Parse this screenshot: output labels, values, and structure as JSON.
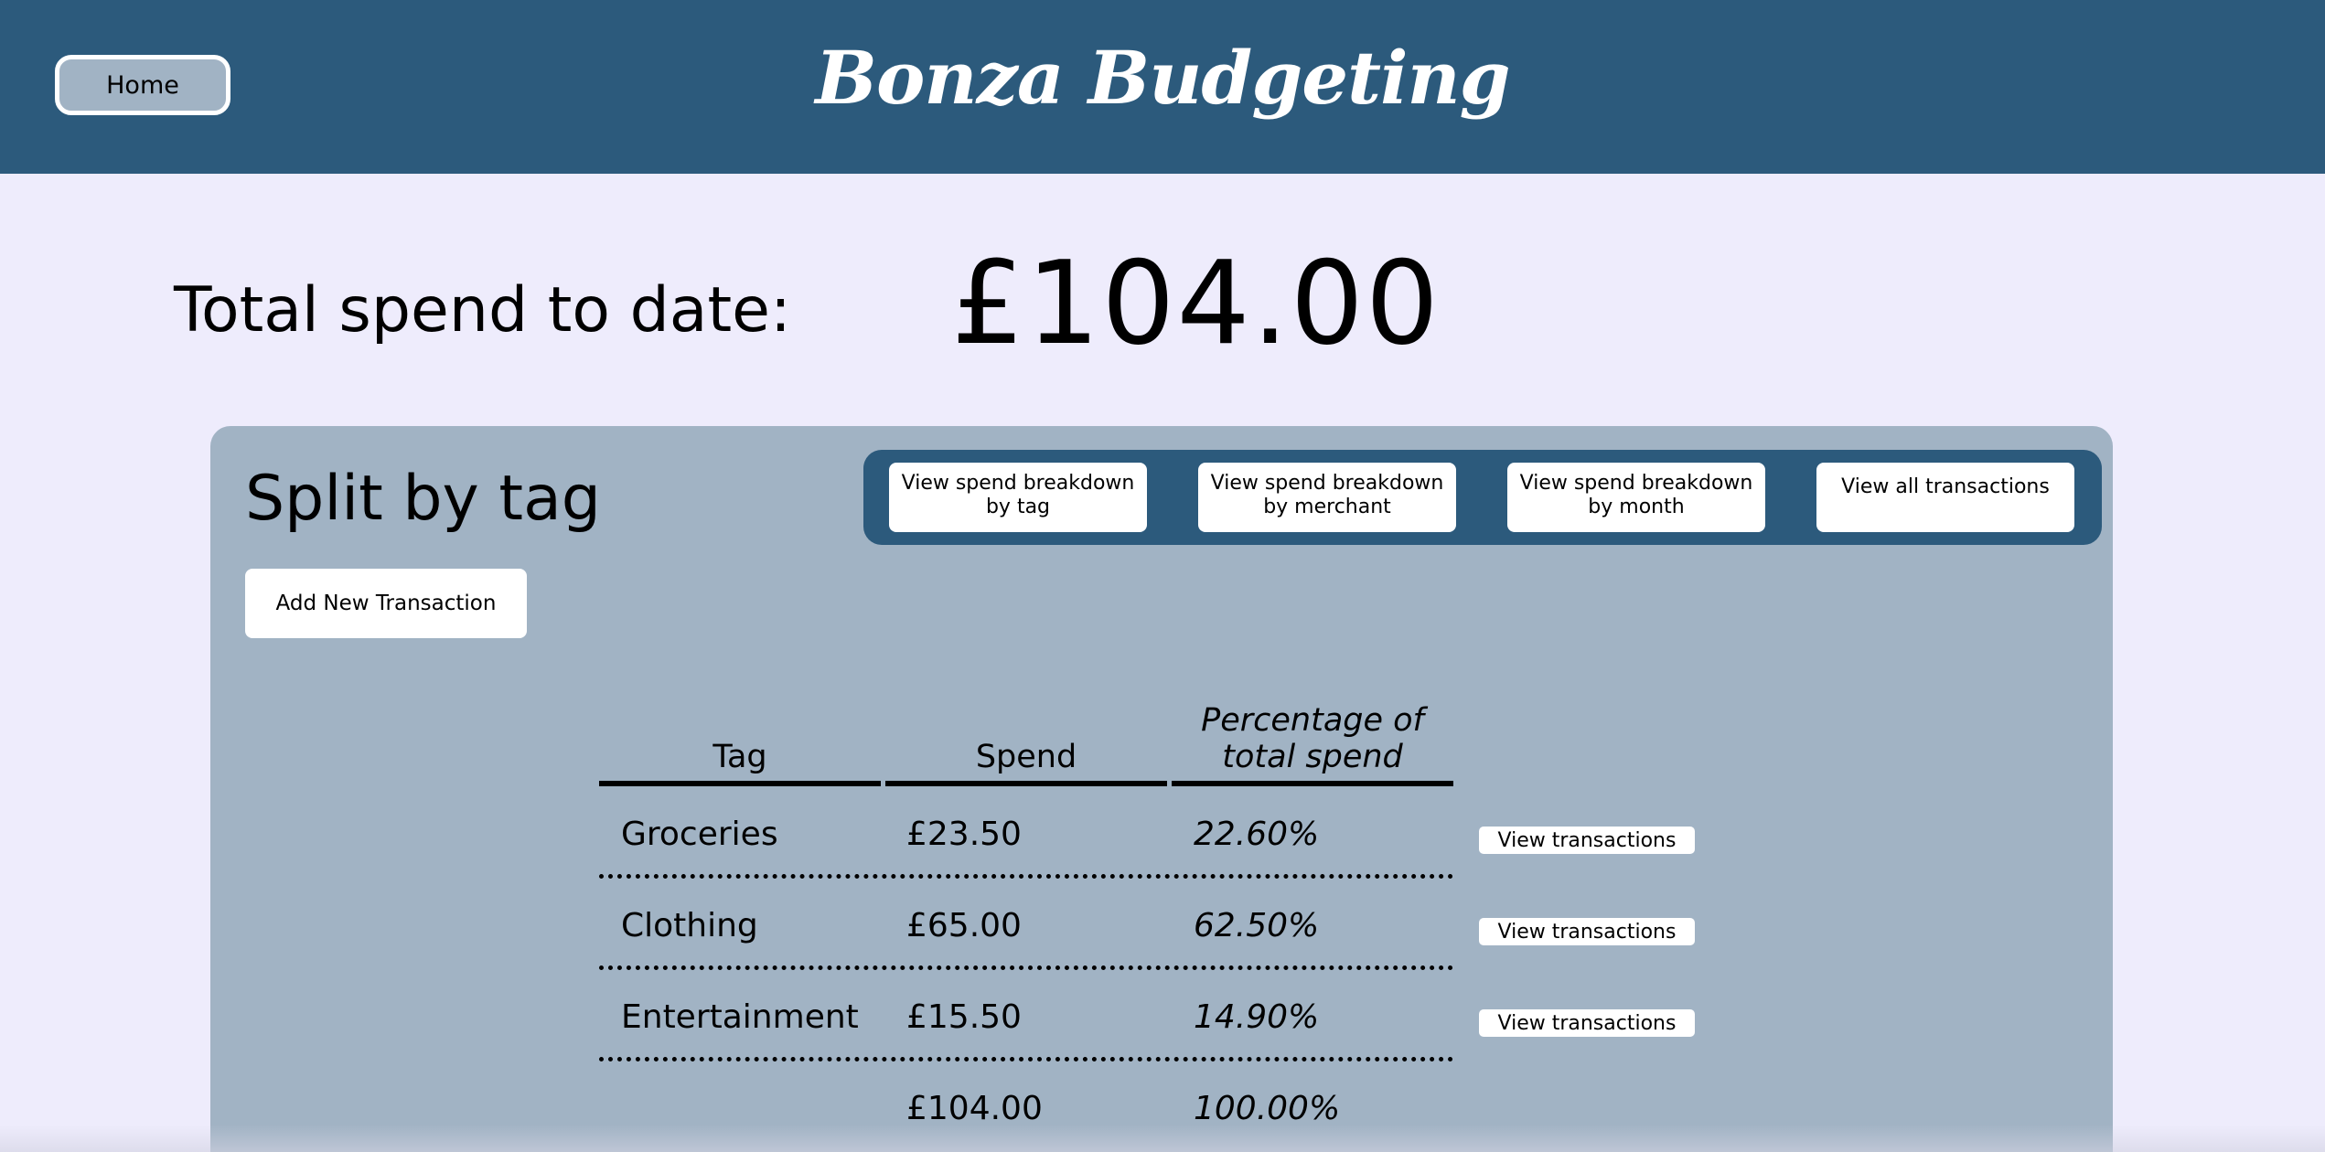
{
  "header": {
    "home_label": "Home",
    "brand": "Bonza Budgeting",
    "bg_color": "#2c5a7c"
  },
  "summary": {
    "total_label": "Total spend to date:",
    "total_value": "£104.00"
  },
  "panel": {
    "title": "Split by tag",
    "add_button": "Add New Transaction",
    "nav_buttons": [
      {
        "label": "View spend breakdown by tag"
      },
      {
        "label": "View spend breakdown by merchant"
      },
      {
        "label": "View spend breakdown by month"
      },
      {
        "label": "View all transactions"
      }
    ]
  },
  "table": {
    "headers": [
      "Tag",
      "Spend",
      "Percentage of total spend"
    ],
    "rows": [
      {
        "tag": "Groceries",
        "spend": "£23.50",
        "percent": "22.60%",
        "action": "View transactions"
      },
      {
        "tag": "Clothing",
        "spend": "£65.00",
        "percent": "62.50%",
        "action": "View transactions"
      },
      {
        "tag": "Entertainment",
        "spend": "£15.50",
        "percent": "14.90%",
        "action": "View transactions"
      }
    ],
    "total": {
      "spend": "£104.00",
      "percent": "100.00%"
    }
  }
}
